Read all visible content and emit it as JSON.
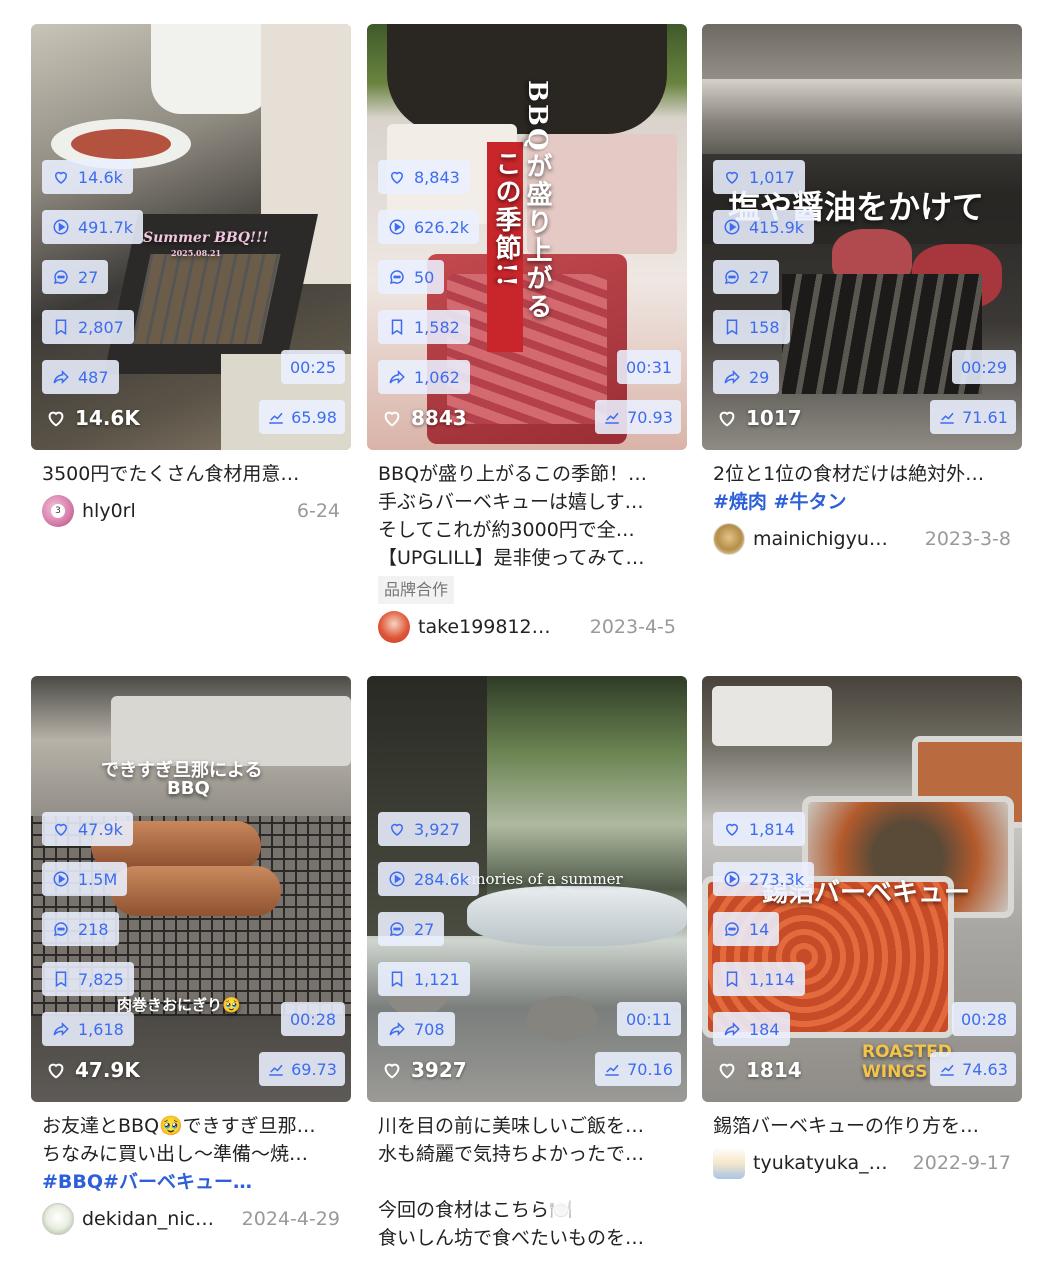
{
  "cards": [
    {
      "stats": {
        "likes": "14.6k",
        "plays": "491.7k",
        "comments": "27",
        "saves": "2,807",
        "shares": "487"
      },
      "duration": "00:25",
      "score": "65.98",
      "likes_big": "14.6K",
      "overlay": "Summer BBQ!!!",
      "overlay2": "2025.08.21",
      "desc_lines": [
        "3500円でたくさん食材用意…"
      ],
      "user": "hly0rl",
      "date": "6-24"
    },
    {
      "stats": {
        "likes": "8,843",
        "plays": "626.2k",
        "comments": "50",
        "saves": "1,582",
        "shares": "1,062"
      },
      "duration": "00:31",
      "score": "70.93",
      "likes_big": "8843",
      "overlay": "BBQが盛り上がる",
      "overlay2": "この季節!!",
      "desc_lines": [
        "BBQが盛り上がるこの季節！…",
        "手ぶらバーベキューは嬉しす…",
        "そしてこれが約3000円で全…",
        "【UPGLILL】是非使ってみて…"
      ],
      "badge": "品牌合作",
      "user": "take199812…",
      "date": "2023-4-5"
    },
    {
      "stats": {
        "likes": "1,017",
        "plays": "415.9k",
        "comments": "27",
        "saves": "158",
        "shares": "29"
      },
      "duration": "00:29",
      "score": "71.61",
      "likes_big": "1017",
      "overlay": "塩や醤油をかけて",
      "desc_lines": [
        "2位と1位の食材だけは絶対外…"
      ],
      "desc_tags": "#焼肉 #牛タン",
      "user": "mainichigyu…",
      "date": "2023-3-8"
    },
    {
      "stats": {
        "likes": "47.9k",
        "plays": "1.5M",
        "comments": "218",
        "saves": "7,825",
        "shares": "1,618"
      },
      "duration": "00:28",
      "score": "69.73",
      "likes_big": "47.9K",
      "overlay": "できすぎ旦那による",
      "overlay2": "BBQ",
      "overlay3": "肉巻きおにぎり🥹",
      "desc_lines": [
        "お友達とBBQ🥹できすぎ旦那…",
        "ちなみに買い出し～準備～焼…"
      ],
      "desc_tags": "#BBQ#バーベキュー…",
      "user": "dekidan_nic…",
      "date": "2024-4-29"
    },
    {
      "stats": {
        "likes": "3,927",
        "plays": "284.6k",
        "comments": "27",
        "saves": "1,121",
        "shares": "708"
      },
      "duration": "00:11",
      "score": "70.16",
      "likes_big": "3927",
      "overlay": "Memories of a summer",
      "desc_lines": [
        "川を目の前に美味しいご飯を…",
        "水も綺麗で気持ちよかったで…",
        "",
        "今回の食材はこちら🍽️",
        "食いしん坊で食べたいものを…"
      ],
      "user": "",
      "date": ""
    },
    {
      "stats": {
        "likes": "1,814",
        "plays": "273.3k",
        "comments": "14",
        "saves": "1,114",
        "shares": "184"
      },
      "duration": "00:28",
      "score": "74.63",
      "likes_big": "1814",
      "overlay": "錫箔バーベキュー",
      "overlay2": "ROASTED WINGS",
      "desc_lines": [
        "錫箔バーベキューの作り方を…"
      ],
      "user": "tyukatyuka_…",
      "date": "2022-9-17"
    }
  ]
}
